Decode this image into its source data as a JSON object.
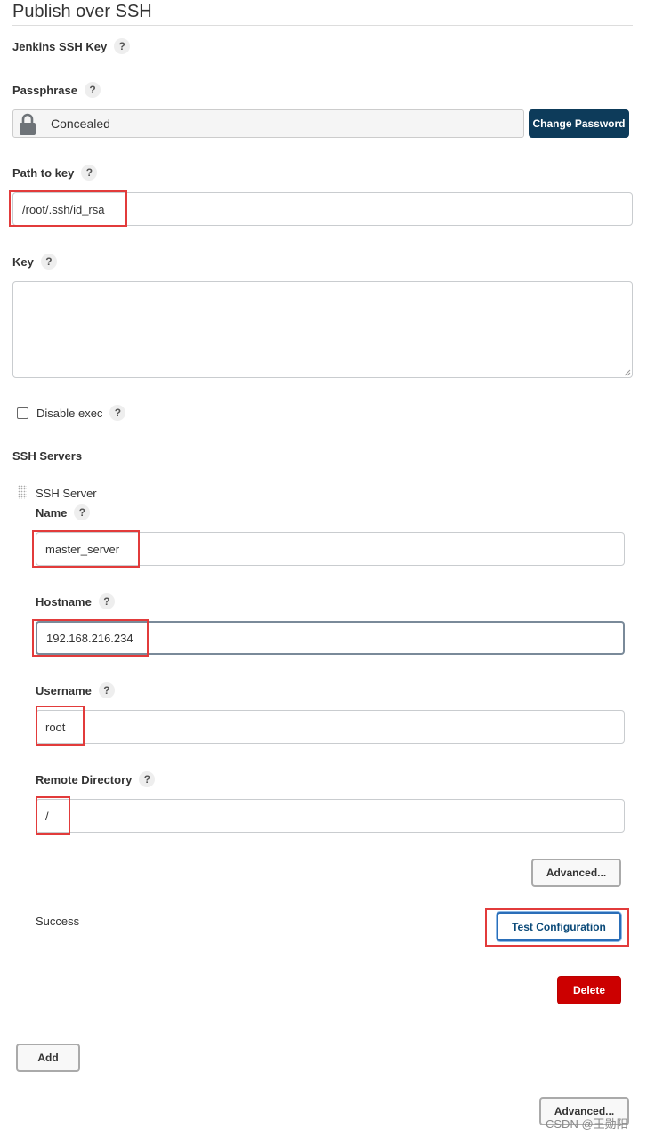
{
  "section": {
    "title": "Publish over SSH"
  },
  "fields": {
    "jenkins_ssh_key": {
      "label": "Jenkins SSH Key"
    },
    "passphrase": {
      "label": "Passphrase",
      "value": "Concealed",
      "change_button": "Change Password"
    },
    "path_to_key": {
      "label": "Path to key",
      "value": "/root/.ssh/id_rsa"
    },
    "key": {
      "label": "Key",
      "value": ""
    },
    "disable_exec": {
      "label": "Disable exec",
      "checked": false
    }
  },
  "help": "?",
  "ssh_servers": {
    "heading": "SSH Servers",
    "server": {
      "title": "SSH Server",
      "name": {
        "label": "Name",
        "value": "master_server"
      },
      "hostname": {
        "label": "Hostname",
        "value": "192.168.216.234"
      },
      "username": {
        "label": "Username",
        "value": "root"
      },
      "remote_directory": {
        "label": "Remote Directory",
        "value": "/"
      },
      "advanced_button": "Advanced...",
      "status": "Success",
      "test_button": "Test Configuration",
      "delete_button": "Delete"
    },
    "add_button": "Add",
    "advanced_button": "Advanced..."
  },
  "watermark": "CSDN @王勋阳",
  "colors": {
    "highlight": "#e23b3b",
    "primary": "#0d3b5a",
    "danger": "#cc0000"
  },
  "icons": {
    "lock": "lock-icon",
    "help": "help-icon",
    "drag": "drag-handle-icon"
  }
}
